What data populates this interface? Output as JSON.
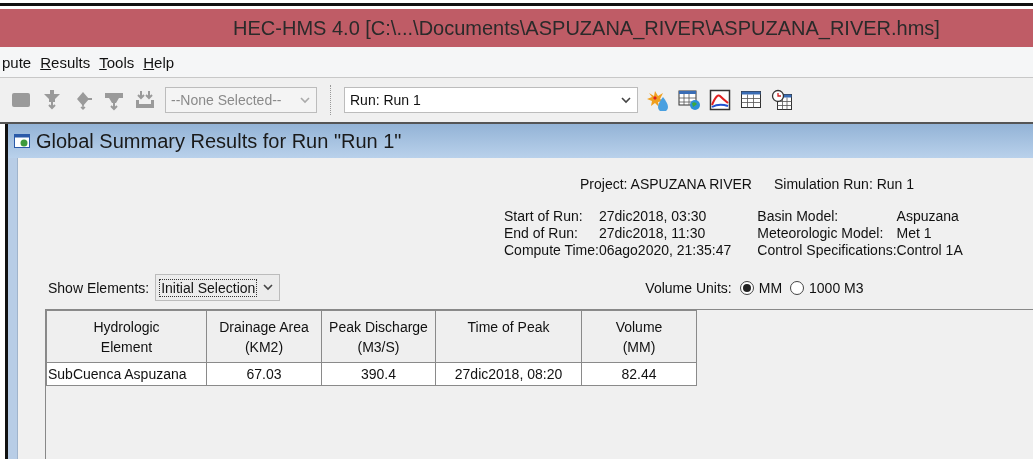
{
  "window": {
    "title": "HEC-HMS 4.0 [C:\\...\\Documents\\ASPUZANA_RIVER\\ASPUZANA_RIVER.hms]"
  },
  "menu": [
    {
      "rest": "pute"
    },
    {
      "key": "R",
      "rest": "esults"
    },
    {
      "key": "T",
      "rest": "ools"
    },
    {
      "key": "H",
      "rest": "elp"
    }
  ],
  "toolbar": {
    "tools_left": [
      {
        "kind": "block",
        "disabled": true
      },
      {
        "kind": "split",
        "disabled": true
      },
      {
        "kind": "junction",
        "disabled": true
      },
      {
        "kind": "sink",
        "disabled": true
      },
      {
        "kind": "source",
        "disabled": true
      }
    ],
    "element_select": {
      "value": "--None Selected--",
      "disabled": true
    },
    "run_select": {
      "value": "Run: Run 1"
    },
    "tools_right": [
      {
        "kind": "burst",
        "disabled": false
      },
      {
        "kind": "globe-table",
        "disabled": false
      },
      {
        "kind": "graph",
        "disabled": false
      },
      {
        "kind": "table",
        "disabled": false
      },
      {
        "kind": "clock-table",
        "disabled": false
      }
    ]
  },
  "frame": {
    "title": "Global Summary Results for Run \"Run 1\""
  },
  "summary": {
    "project": "Project: ASPUZANA RIVER",
    "simulation_run": "Simulation Run: Run 1",
    "times": [
      {
        "label": "Start of Run:",
        "value": "27dic2018, 03:30"
      },
      {
        "label": "End of Run:",
        "value": "27dic2018, 11:30"
      },
      {
        "label": "Compute Time:",
        "value": "06ago2020, 21:35:47"
      }
    ],
    "models": [
      {
        "label": "Basin Model:",
        "value": "Aspuzana"
      },
      {
        "label": "Meteorologic Model:",
        "value": "Met 1"
      },
      {
        "label": "Control Specifications:",
        "value": "Control 1A"
      }
    ]
  },
  "show_elements": {
    "label": "Show Elements:",
    "value": "Initial Selection"
  },
  "volume_units": {
    "label": "Volume Units:",
    "options": [
      {
        "label": "MM",
        "selected": true
      },
      {
        "label": "1000 M3",
        "selected": false
      }
    ]
  },
  "table": {
    "columns": [
      "Hydrologic\nElement",
      "Drainage Area\n(KM2)",
      "Peak Discharge\n(M3/S)",
      "Time of Peak",
      "Volume\n(MM)"
    ],
    "rows": [
      [
        "SubCuenca Aspuzana",
        "67.03",
        "390.4",
        "27dic2018, 08:20",
        "82.44"
      ]
    ]
  }
}
